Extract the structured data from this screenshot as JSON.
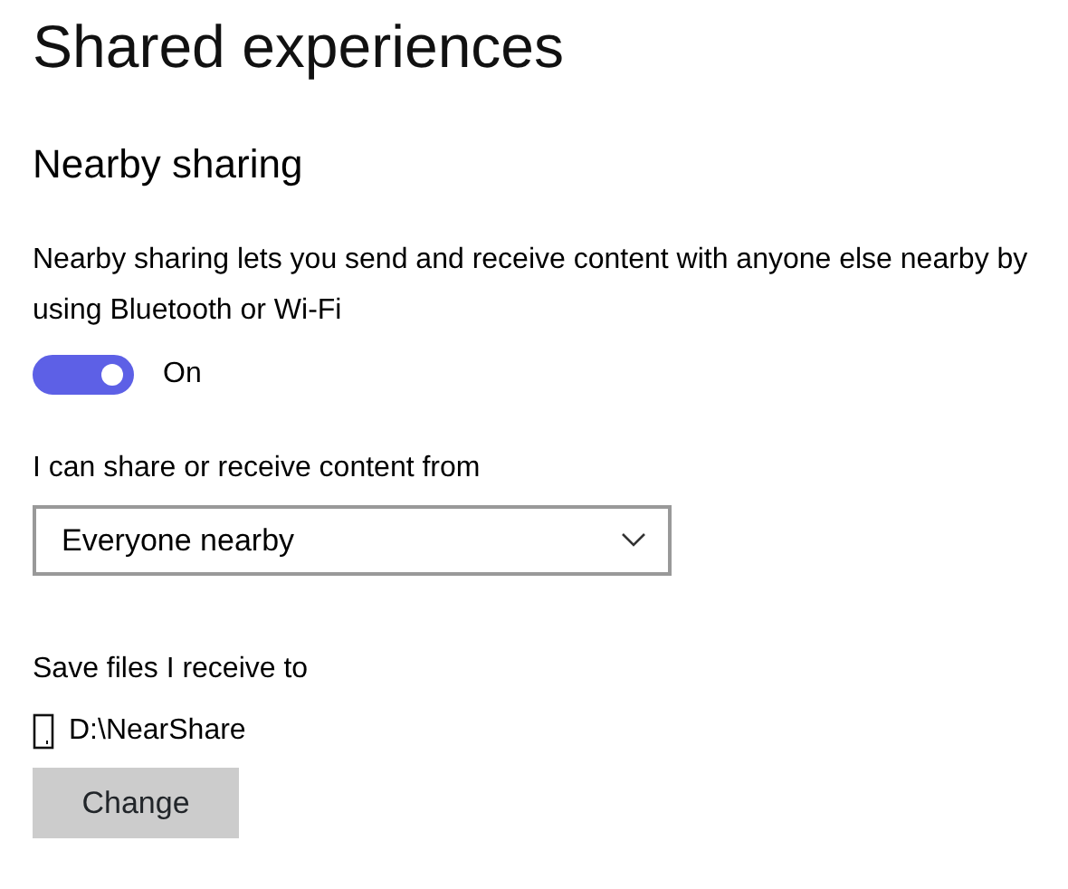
{
  "page": {
    "title": "Shared experiences"
  },
  "section": {
    "heading": "Nearby sharing",
    "description": "Nearby sharing lets you send and receive content with anyone else nearby by using Bluetooth or Wi-Fi",
    "toggle": {
      "on": true,
      "label": "On"
    },
    "share_from": {
      "label": "I can share or receive content from",
      "value": "Everyone nearby"
    },
    "save_location": {
      "label": "Save files I receive to",
      "path": "D:\\NearShare",
      "button": "Change"
    }
  }
}
